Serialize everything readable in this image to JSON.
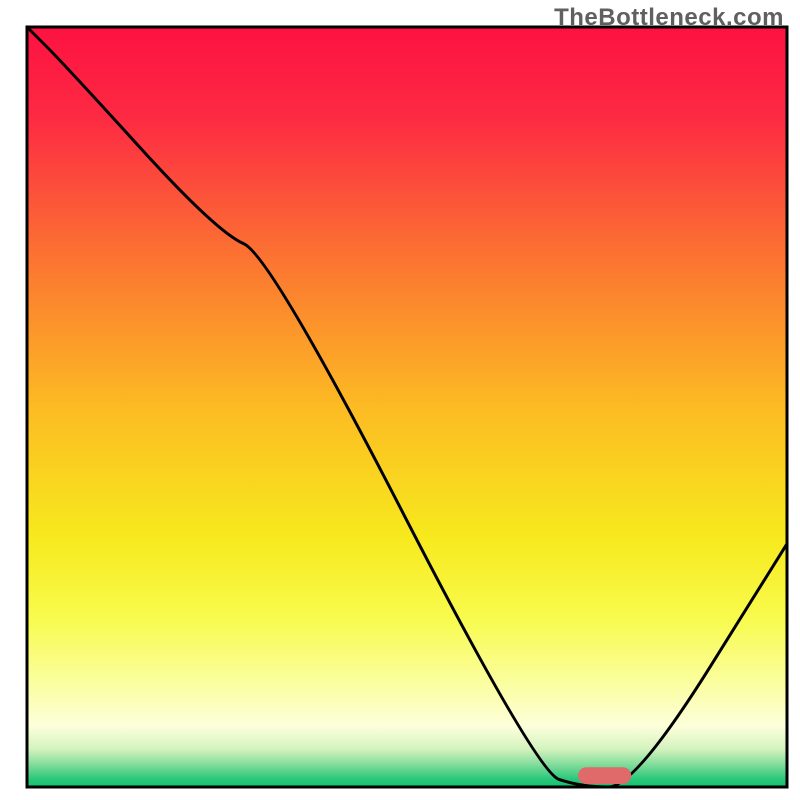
{
  "watermark": "TheBottleneck.com",
  "chart_data": {
    "type": "line",
    "title": "",
    "xlabel": "",
    "ylabel": "",
    "xlim": [
      0,
      100
    ],
    "ylim": [
      0,
      100
    ],
    "grid": false,
    "legend": false,
    "series": [
      {
        "name": "bottleneck-curve",
        "x": [
          0,
          5,
          25,
          32,
          67,
          73,
          80,
          100
        ],
        "values": [
          100,
          95,
          73,
          70,
          2,
          0,
          0,
          32
        ]
      }
    ],
    "annotations": [
      {
        "name": "marker-pill",
        "shape": "rounded-rect",
        "center_x": 76,
        "center_y": 1.5,
        "width": 7,
        "height": 2.2,
        "fill": "#e06a6a"
      }
    ],
    "background_gradient": {
      "type": "vertical",
      "stops": [
        {
          "y": 0,
          "color": "#fd1241"
        },
        {
          "y": 12,
          "color": "#fd2a43"
        },
        {
          "y": 30,
          "color": "#fc7232"
        },
        {
          "y": 50,
          "color": "#fcbb23"
        },
        {
          "y": 67,
          "color": "#f7e91d"
        },
        {
          "y": 78,
          "color": "#f8fb4e"
        },
        {
          "y": 87,
          "color": "#fbfea6"
        },
        {
          "y": 92,
          "color": "#fdffdb"
        },
        {
          "y": 95,
          "color": "#d4f3be"
        },
        {
          "y": 97,
          "color": "#84dd9c"
        },
        {
          "y": 99,
          "color": "#28c779"
        },
        {
          "y": 100,
          "color": "#0fc36e"
        }
      ]
    },
    "border_color": "#000000",
    "curve_color": "#000000",
    "curve_width": 3
  }
}
